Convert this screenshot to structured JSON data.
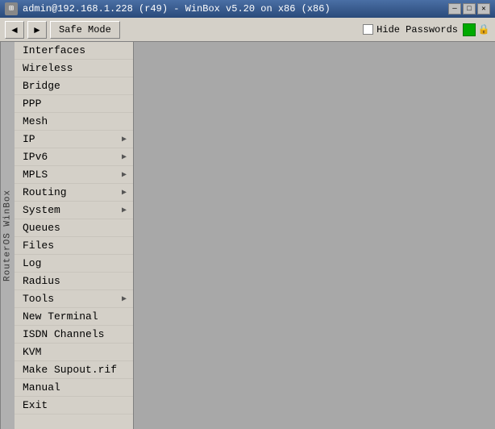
{
  "titleBar": {
    "title": "admin@192.168.1.228 (r49) - WinBox v5.20 on x86 (x86)",
    "icon": "⊞",
    "controls": {
      "minimize": "─",
      "maximize": "□",
      "close": "✕"
    }
  },
  "toolbar": {
    "backLabel": "◄",
    "forwardLabel": "►",
    "safeModeLabel": "Safe Mode",
    "hidePasswordsLabel": "Hide Passwords",
    "statusIconColor": "#00aa00",
    "lockIcon": "🔒"
  },
  "sidebar": {
    "verticalLabel": "RouterOS WinBox",
    "items": [
      {
        "label": "Interfaces",
        "hasArrow": false
      },
      {
        "label": "Wireless",
        "hasArrow": false
      },
      {
        "label": "Bridge",
        "hasArrow": false
      },
      {
        "label": "PPP",
        "hasArrow": false
      },
      {
        "label": "Mesh",
        "hasArrow": false
      },
      {
        "label": "IP",
        "hasArrow": true
      },
      {
        "label": "IPv6",
        "hasArrow": true
      },
      {
        "label": "MPLS",
        "hasArrow": true
      },
      {
        "label": "Routing",
        "hasArrow": true
      },
      {
        "label": "System",
        "hasArrow": true
      },
      {
        "label": "Queues",
        "hasArrow": false
      },
      {
        "label": "Files",
        "hasArrow": false
      },
      {
        "label": "Log",
        "hasArrow": false
      },
      {
        "label": "Radius",
        "hasArrow": false
      },
      {
        "label": "Tools",
        "hasArrow": true
      },
      {
        "label": "New Terminal",
        "hasArrow": false
      },
      {
        "label": "ISDN Channels",
        "hasArrow": false
      },
      {
        "label": "KVM",
        "hasArrow": false
      },
      {
        "label": "Make Supout.rif",
        "hasArrow": false
      },
      {
        "label": "Manual",
        "hasArrow": false
      },
      {
        "label": "Exit",
        "hasArrow": false
      }
    ]
  }
}
